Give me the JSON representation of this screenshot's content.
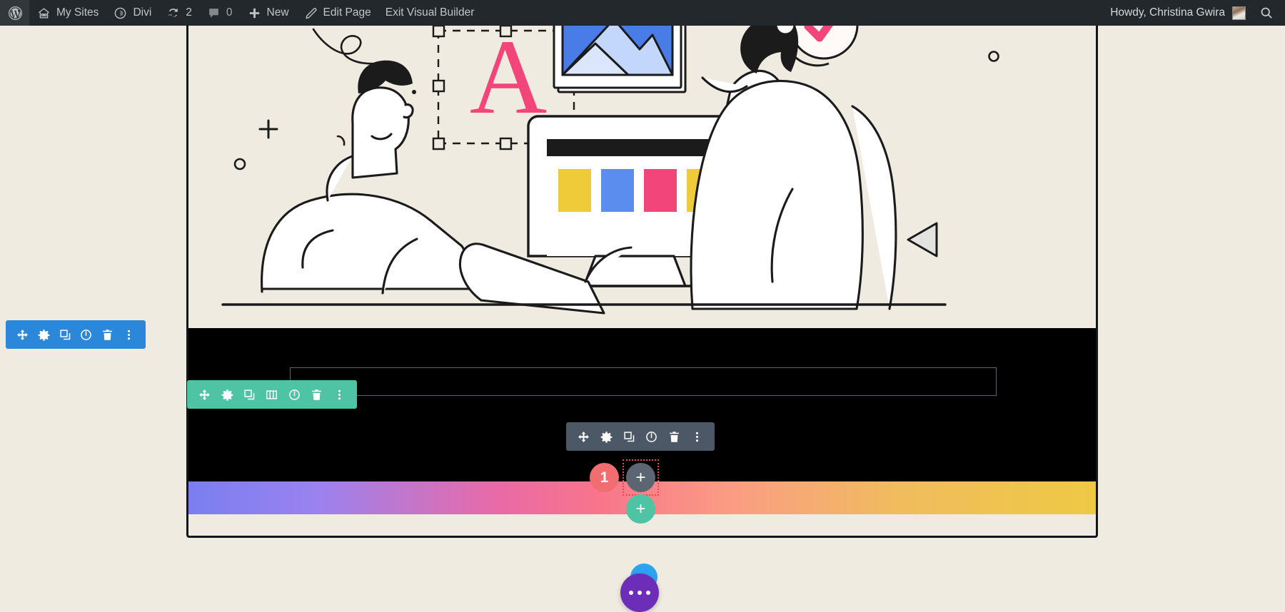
{
  "adminbar": {
    "logo_icon": "wordpress-logo-icon",
    "items": [
      {
        "icon": "home-icon",
        "label": "My Sites"
      },
      {
        "icon": "divi-icon",
        "label": "Divi"
      },
      {
        "icon": "updates-icon",
        "label": "2"
      },
      {
        "icon": "comments-icon",
        "label": "0"
      },
      {
        "icon": "plus-icon",
        "label": "New"
      },
      {
        "icon": "pencil-icon",
        "label": "Edit Page"
      },
      {
        "icon": "",
        "label": "Exit Visual Builder"
      }
    ],
    "howdy": "Howdy, Christina Gwira",
    "avatar_name": "user-avatar",
    "search_icon": "search-icon"
  },
  "toolbars": {
    "section": {
      "name": "section-settings-toolbar",
      "color": "#2b87da",
      "icons": [
        "move-icon",
        "gear-icon",
        "duplicate-icon",
        "disable-icon",
        "trash-icon",
        "more-options-icon"
      ]
    },
    "row": {
      "name": "row-settings-toolbar",
      "color": "#4ec4a5",
      "icons": [
        "move-icon",
        "gear-icon",
        "duplicate-icon",
        "columns-icon",
        "disable-icon",
        "trash-icon",
        "more-options-icon"
      ]
    },
    "module": {
      "name": "module-settings-toolbar",
      "color": "#4c5866",
      "icons": [
        "move-icon",
        "gear-icon",
        "duplicate-icon",
        "disable-icon",
        "trash-icon",
        "more-options-icon"
      ]
    }
  },
  "buttons": {
    "count_badge": "1",
    "add_module": "+",
    "add_row": "+",
    "fab_icon": "three-dots-icon"
  },
  "colors": {
    "page_bg": "#EFEBE0",
    "section_black": "#000000",
    "adminbar_bg": "#23282d",
    "accent_blue": "#2b87da",
    "accent_teal": "#4ec4a5",
    "accent_gray": "#4c5866",
    "badge_red": "#f16d70",
    "selection_red": "#e8454d",
    "fab_purple": "#6c2eb9",
    "fab_blue": "#2ea3f2",
    "swatch_yellow": "#EFCB3A",
    "swatch_blue": "#5B8DEF",
    "swatch_pink": "#F2467A",
    "illustration_pink": "#F2467A",
    "gradient_start": "#7b7ef0",
    "gradient_mid": "#f8758c",
    "gradient_end": "#eec944"
  },
  "illustration": {
    "name": "web-design-team-illustration",
    "letter_glyph": "A",
    "elements": [
      "seated-man",
      "standing-person",
      "monitor",
      "image-placeholder",
      "checkmark-circle",
      "dashed-selection-box",
      "squiggle",
      "triangle",
      "plus-mark",
      "circle-mark"
    ]
  }
}
